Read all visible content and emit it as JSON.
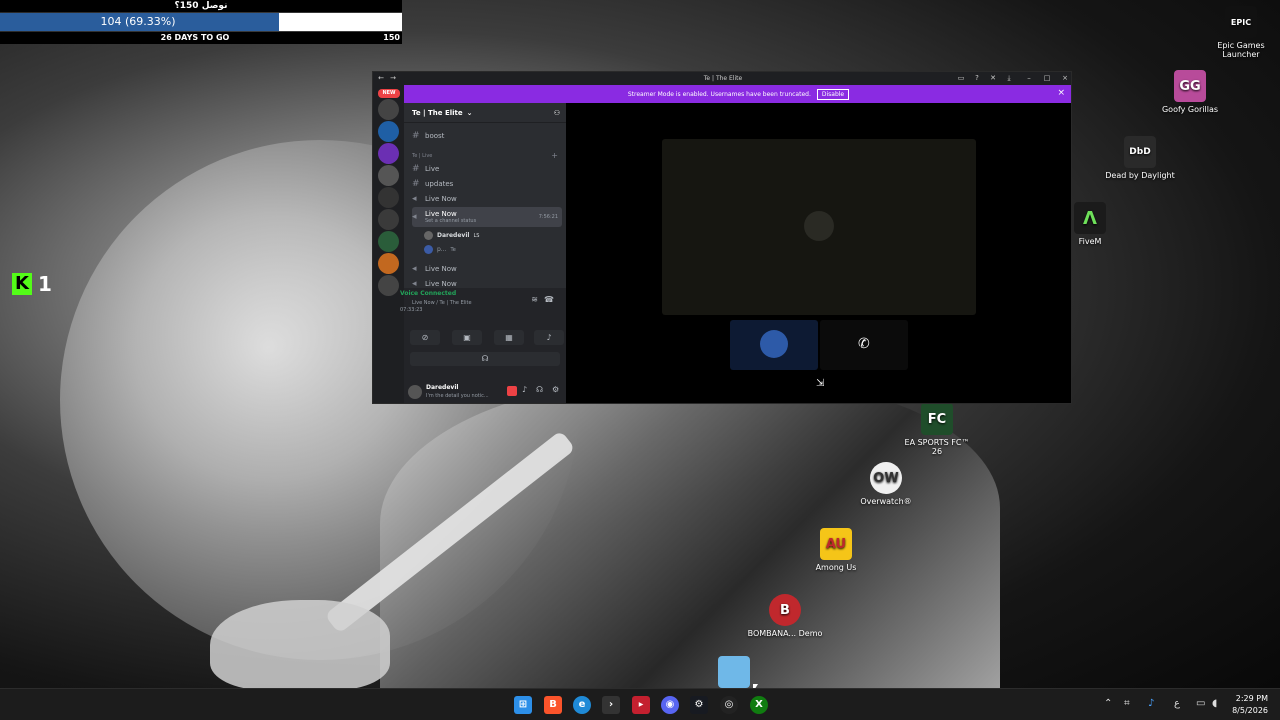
{
  "overlay": {
    "goal_title": "نوصل 150؟",
    "progress_text": "104 (69.33%)",
    "progress_fraction": 0.6933,
    "days_left": "26 DAYS TO GO",
    "goal_target": "150",
    "kick_count": "1"
  },
  "desktop_icons": [
    {
      "label": "Epic Games Launcher",
      "glyph": "EPIC",
      "color": "#111111"
    },
    {
      "label": "Goofy Gorillas",
      "glyph": "GG",
      "color": "#b84b9a"
    },
    {
      "label": "Dead by Daylight",
      "glyph": "DbD",
      "color": "#2a2a2a"
    },
    {
      "label": "FiveM",
      "glyph": "Λ",
      "color": "#1b1b1b"
    },
    {
      "label": "EA SPORTS FC™ 26",
      "glyph": "FC",
      "color": "#1f4d2a"
    },
    {
      "label": "Overwatch®",
      "glyph": "OW",
      "color": "#f0f0f0"
    },
    {
      "label": "Among Us",
      "glyph": "AU",
      "color": "#f5c518"
    },
    {
      "label": "BOMBANA... Demo",
      "glyph": "B",
      "color": "#c0282d"
    }
  ],
  "discord": {
    "window_title": "Te | The Elite",
    "banner_text": "Streamer Mode is enabled. Usernames have been truncated.",
    "banner_button": "Disable",
    "new_badge": "NEW",
    "server_name": "Te | The Elite",
    "category": "Te | Live",
    "channels": [
      {
        "name": "boost",
        "type": "text"
      },
      {
        "name": "Live",
        "type": "text"
      },
      {
        "name": "updates",
        "type": "text"
      },
      {
        "name": "Live Now",
        "type": "voice"
      },
      {
        "name": "Live Now",
        "type": "voice"
      },
      {
        "name": "Live Now",
        "type": "voice"
      },
      {
        "name": "Live Now",
        "type": "voice"
      }
    ],
    "active_channel_status": "Set a channel status",
    "active_channel_timer": "7:56:21",
    "voice_members": [
      {
        "name": "Daredevil",
        "tag": "LS"
      },
      {
        "name": "p...",
        "tag": "Te"
      }
    ],
    "voice_status": "Voice Connected",
    "voice_location": "Live Now / Te | The Elite",
    "voice_timer": "07:33:23",
    "user_name": "Daredevil",
    "user_status": "I'm the detail you notic..."
  },
  "taskbar": {
    "time": "2:29 PM",
    "date": "8/5/2026",
    "lang": "ع"
  }
}
